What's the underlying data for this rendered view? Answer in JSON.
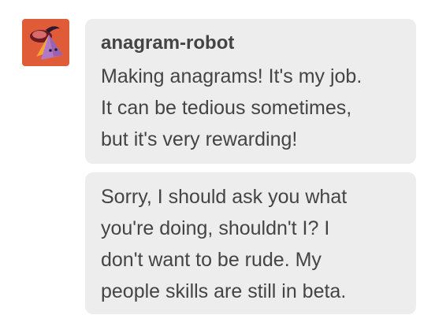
{
  "sender": {
    "name": "anagram-robot",
    "avatar_icon": "robot-avatar-icon",
    "avatar_bg": "#e05c39"
  },
  "messages": [
    {
      "text": "Making anagrams! It's my job.\nIt can be tedious sometimes,\nbut it's very rewarding!"
    },
    {
      "text": "Sorry, I should ask you what\nyou're doing, shouldn't I? I\ndon't want to be rude. My\npeople skills are still in beta."
    }
  ],
  "colors": {
    "bubble_bg": "#ededed",
    "text": "#444444"
  }
}
